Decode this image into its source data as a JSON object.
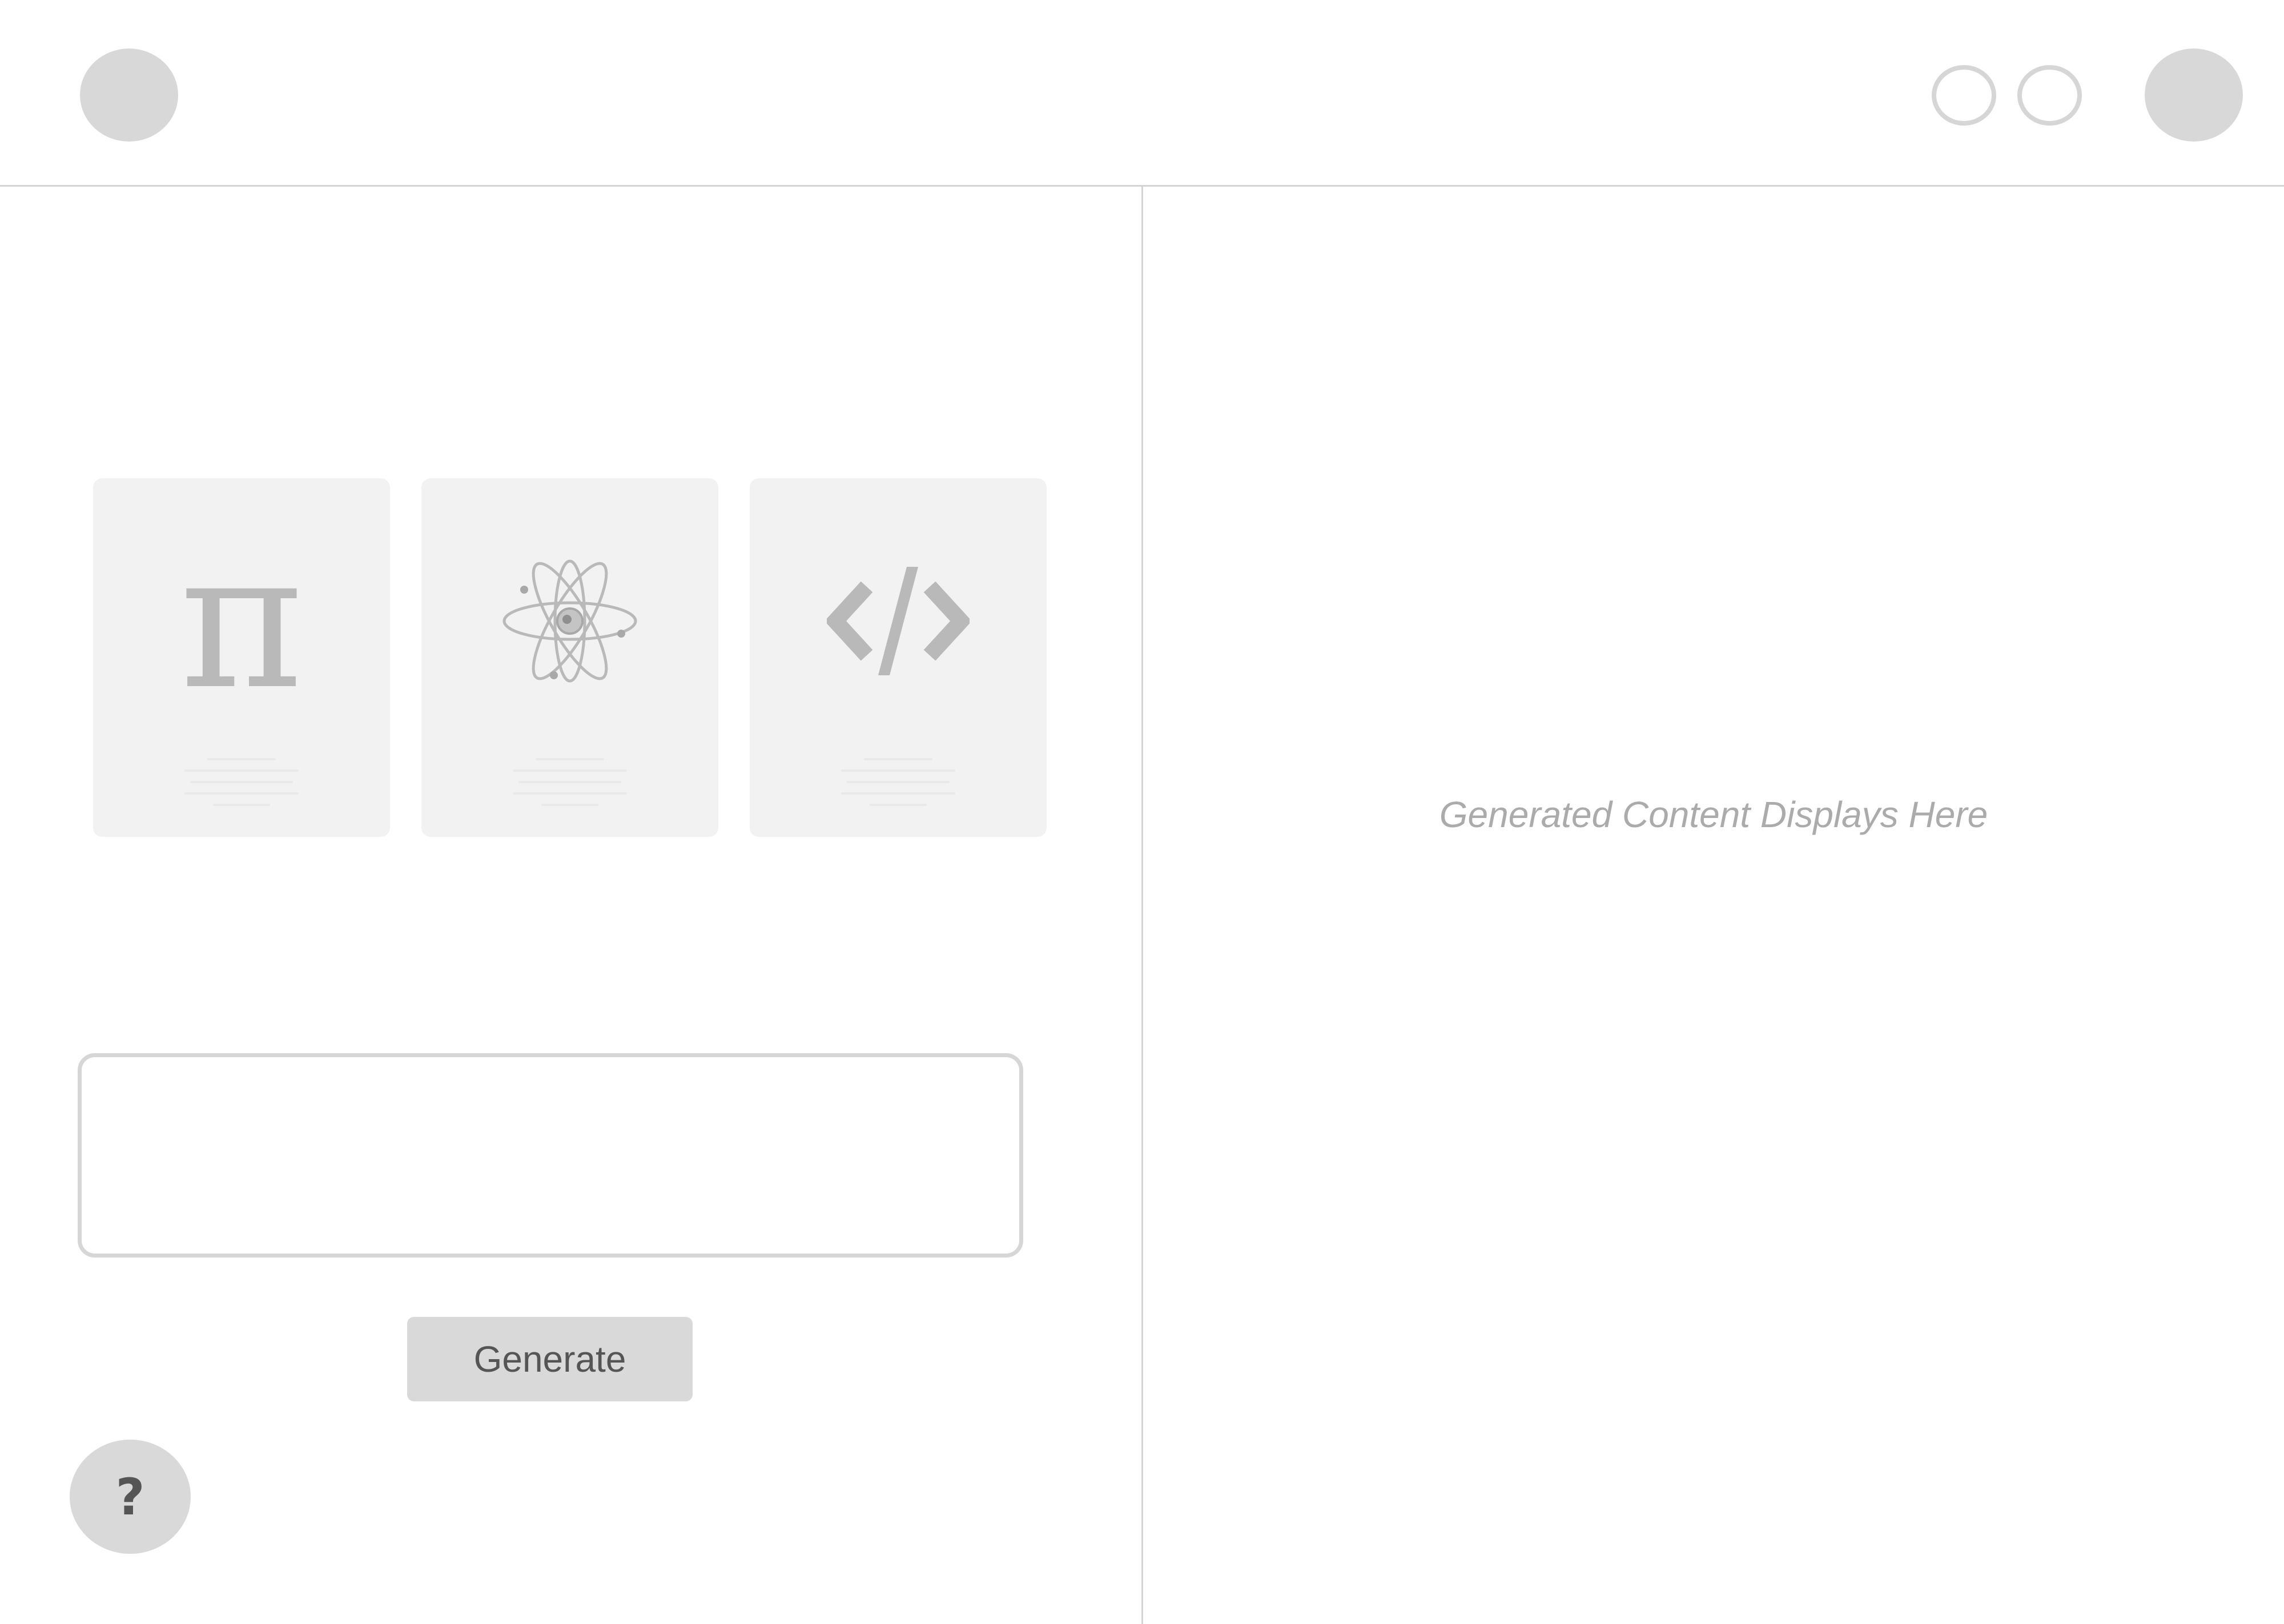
{
  "header": {
    "logo_icon": "logo-circle",
    "controls": [
      "circle-outline",
      "circle-outline"
    ],
    "avatar_icon": "avatar-circle"
  },
  "cards": [
    {
      "icon": "pi-icon",
      "glyph": "π"
    },
    {
      "icon": "atom-icon"
    },
    {
      "icon": "code-icon",
      "glyph": "</>"
    }
  ],
  "prompt": {
    "value": "",
    "placeholder": ""
  },
  "generate_label": "Generate",
  "help_label": "?",
  "output": {
    "placeholder": "Generated Content Displays Here"
  },
  "colors": {
    "background": "#ffffff",
    "card_bg": "#f2f2f2",
    "icon_gray": "#b9b9b9",
    "button_bg": "#d9d9d9",
    "border": "#d4d4d4",
    "placeholder_text": "#ababab"
  }
}
